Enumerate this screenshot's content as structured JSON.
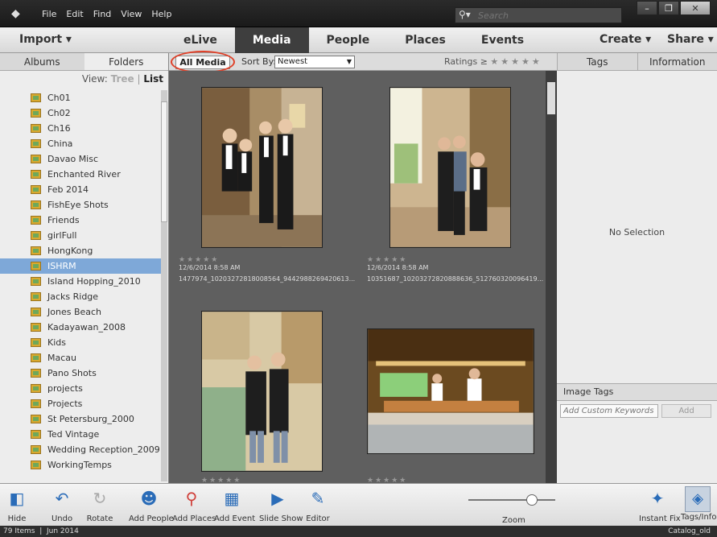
{
  "menubar": {
    "items": [
      "File",
      "Edit",
      "Find",
      "View",
      "Help"
    ]
  },
  "search": {
    "placeholder": "Search"
  },
  "topnav": {
    "import_label": "Import ▾",
    "tabs": [
      "eLive",
      "Media",
      "People",
      "Places",
      "Events"
    ],
    "active_tab": "Media",
    "create_label": "Create ▾",
    "share_label": "Share ▾"
  },
  "left_panel": {
    "tabs": [
      "Albums",
      "Folders"
    ],
    "active_tab": "Folders",
    "view_label": "View:",
    "view_tree": "Tree",
    "view_list": "List",
    "folders": [
      "Ch01",
      "Ch02",
      "Ch16",
      "China",
      "Davao Misc",
      "Enchanted River",
      "Feb 2014",
      "FishEye Shots",
      "Friends",
      "girlFull",
      "HongKong",
      "ISHRM",
      "Island Hopping_2010",
      "Jacks Ridge",
      "Jones Beach",
      "Kadayawan_2008",
      "Kids",
      "Macau",
      "Pano Shots",
      "projects",
      "Projects",
      "St Petersburg_2000",
      "Ted Vintage",
      "Wedding Reception_2009",
      "WorkingTemps"
    ],
    "selected_folder": "ISHRM"
  },
  "center": {
    "all_media_label": "All Media",
    "sort_by_label": "Sort By:",
    "sort_value": "Newest",
    "ratings_label": "Ratings ≥",
    "ratings_stars": "★★★★★",
    "thumbnails": [
      {
        "date": "12/6/2014 8:58 AM",
        "filename": "1477974_10203272818008564_9442988269420613...",
        "stars": "★★★★★"
      },
      {
        "date": "12/6/2014 8:58 AM",
        "filename": "10351687_10203272820888636_512760320096419...",
        "stars": "★★★★★"
      },
      {
        "date": "",
        "filename": "",
        "stars": "★★★★★"
      },
      {
        "date": "",
        "filename": "",
        "stars": "★★★★★"
      }
    ]
  },
  "right_panel": {
    "tabs": [
      "Tags",
      "Information"
    ],
    "no_selection": "No Selection",
    "image_tags_label": "Image Tags",
    "keyword_placeholder": "Add Custom Keywords",
    "add_label": "Add"
  },
  "toolbar": {
    "hide": "Hide",
    "undo": "Undo",
    "rotate": "Rotate",
    "add_people": "Add People",
    "add_places": "Add Places",
    "add_event": "Add Event",
    "slide_show": "Slide Show",
    "editor": "Editor",
    "zoom": "Zoom",
    "instant_fix": "Instant Fix",
    "tags_info": "Tags/Info",
    "zoom_level": 0.67
  },
  "status": {
    "items": "79 Items",
    "date": "Jun 2014",
    "catalog": "Catalog_old"
  },
  "colors": {
    "accent": "#2a6cb8",
    "selection": "#7ea8d8",
    "highlight_circle": "#e04028"
  }
}
